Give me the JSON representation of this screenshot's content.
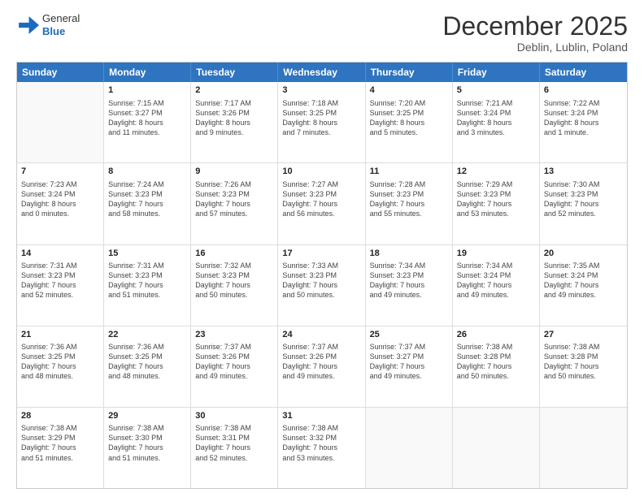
{
  "header": {
    "logo": {
      "general": "General",
      "blue": "Blue"
    },
    "title": "December 2025",
    "subtitle": "Deblin, Lublin, Poland"
  },
  "calendar": {
    "days": [
      "Sunday",
      "Monday",
      "Tuesday",
      "Wednesday",
      "Thursday",
      "Friday",
      "Saturday"
    ],
    "rows": [
      [
        {
          "num": "",
          "lines": []
        },
        {
          "num": "1",
          "lines": [
            "Sunrise: 7:15 AM",
            "Sunset: 3:27 PM",
            "Daylight: 8 hours",
            "and 11 minutes."
          ]
        },
        {
          "num": "2",
          "lines": [
            "Sunrise: 7:17 AM",
            "Sunset: 3:26 PM",
            "Daylight: 8 hours",
            "and 9 minutes."
          ]
        },
        {
          "num": "3",
          "lines": [
            "Sunrise: 7:18 AM",
            "Sunset: 3:25 PM",
            "Daylight: 8 hours",
            "and 7 minutes."
          ]
        },
        {
          "num": "4",
          "lines": [
            "Sunrise: 7:20 AM",
            "Sunset: 3:25 PM",
            "Daylight: 8 hours",
            "and 5 minutes."
          ]
        },
        {
          "num": "5",
          "lines": [
            "Sunrise: 7:21 AM",
            "Sunset: 3:24 PM",
            "Daylight: 8 hours",
            "and 3 minutes."
          ]
        },
        {
          "num": "6",
          "lines": [
            "Sunrise: 7:22 AM",
            "Sunset: 3:24 PM",
            "Daylight: 8 hours",
            "and 1 minute."
          ]
        }
      ],
      [
        {
          "num": "7",
          "lines": [
            "Sunrise: 7:23 AM",
            "Sunset: 3:24 PM",
            "Daylight: 8 hours",
            "and 0 minutes."
          ]
        },
        {
          "num": "8",
          "lines": [
            "Sunrise: 7:24 AM",
            "Sunset: 3:23 PM",
            "Daylight: 7 hours",
            "and 58 minutes."
          ]
        },
        {
          "num": "9",
          "lines": [
            "Sunrise: 7:26 AM",
            "Sunset: 3:23 PM",
            "Daylight: 7 hours",
            "and 57 minutes."
          ]
        },
        {
          "num": "10",
          "lines": [
            "Sunrise: 7:27 AM",
            "Sunset: 3:23 PM",
            "Daylight: 7 hours",
            "and 56 minutes."
          ]
        },
        {
          "num": "11",
          "lines": [
            "Sunrise: 7:28 AM",
            "Sunset: 3:23 PM",
            "Daylight: 7 hours",
            "and 55 minutes."
          ]
        },
        {
          "num": "12",
          "lines": [
            "Sunrise: 7:29 AM",
            "Sunset: 3:23 PM",
            "Daylight: 7 hours",
            "and 53 minutes."
          ]
        },
        {
          "num": "13",
          "lines": [
            "Sunrise: 7:30 AM",
            "Sunset: 3:23 PM",
            "Daylight: 7 hours",
            "and 52 minutes."
          ]
        }
      ],
      [
        {
          "num": "14",
          "lines": [
            "Sunrise: 7:31 AM",
            "Sunset: 3:23 PM",
            "Daylight: 7 hours",
            "and 52 minutes."
          ]
        },
        {
          "num": "15",
          "lines": [
            "Sunrise: 7:31 AM",
            "Sunset: 3:23 PM",
            "Daylight: 7 hours",
            "and 51 minutes."
          ]
        },
        {
          "num": "16",
          "lines": [
            "Sunrise: 7:32 AM",
            "Sunset: 3:23 PM",
            "Daylight: 7 hours",
            "and 50 minutes."
          ]
        },
        {
          "num": "17",
          "lines": [
            "Sunrise: 7:33 AM",
            "Sunset: 3:23 PM",
            "Daylight: 7 hours",
            "and 50 minutes."
          ]
        },
        {
          "num": "18",
          "lines": [
            "Sunrise: 7:34 AM",
            "Sunset: 3:23 PM",
            "Daylight: 7 hours",
            "and 49 minutes."
          ]
        },
        {
          "num": "19",
          "lines": [
            "Sunrise: 7:34 AM",
            "Sunset: 3:24 PM",
            "Daylight: 7 hours",
            "and 49 minutes."
          ]
        },
        {
          "num": "20",
          "lines": [
            "Sunrise: 7:35 AM",
            "Sunset: 3:24 PM",
            "Daylight: 7 hours",
            "and 49 minutes."
          ]
        }
      ],
      [
        {
          "num": "21",
          "lines": [
            "Sunrise: 7:36 AM",
            "Sunset: 3:25 PM",
            "Daylight: 7 hours",
            "and 48 minutes."
          ]
        },
        {
          "num": "22",
          "lines": [
            "Sunrise: 7:36 AM",
            "Sunset: 3:25 PM",
            "Daylight: 7 hours",
            "and 48 minutes."
          ]
        },
        {
          "num": "23",
          "lines": [
            "Sunrise: 7:37 AM",
            "Sunset: 3:26 PM",
            "Daylight: 7 hours",
            "and 49 minutes."
          ]
        },
        {
          "num": "24",
          "lines": [
            "Sunrise: 7:37 AM",
            "Sunset: 3:26 PM",
            "Daylight: 7 hours",
            "and 49 minutes."
          ]
        },
        {
          "num": "25",
          "lines": [
            "Sunrise: 7:37 AM",
            "Sunset: 3:27 PM",
            "Daylight: 7 hours",
            "and 49 minutes."
          ]
        },
        {
          "num": "26",
          "lines": [
            "Sunrise: 7:38 AM",
            "Sunset: 3:28 PM",
            "Daylight: 7 hours",
            "and 50 minutes."
          ]
        },
        {
          "num": "27",
          "lines": [
            "Sunrise: 7:38 AM",
            "Sunset: 3:28 PM",
            "Daylight: 7 hours",
            "and 50 minutes."
          ]
        }
      ],
      [
        {
          "num": "28",
          "lines": [
            "Sunrise: 7:38 AM",
            "Sunset: 3:29 PM",
            "Daylight: 7 hours",
            "and 51 minutes."
          ]
        },
        {
          "num": "29",
          "lines": [
            "Sunrise: 7:38 AM",
            "Sunset: 3:30 PM",
            "Daylight: 7 hours",
            "and 51 minutes."
          ]
        },
        {
          "num": "30",
          "lines": [
            "Sunrise: 7:38 AM",
            "Sunset: 3:31 PM",
            "Daylight: 7 hours",
            "and 52 minutes."
          ]
        },
        {
          "num": "31",
          "lines": [
            "Sunrise: 7:38 AM",
            "Sunset: 3:32 PM",
            "Daylight: 7 hours",
            "and 53 minutes."
          ]
        },
        {
          "num": "",
          "lines": []
        },
        {
          "num": "",
          "lines": []
        },
        {
          "num": "",
          "lines": []
        }
      ]
    ]
  }
}
